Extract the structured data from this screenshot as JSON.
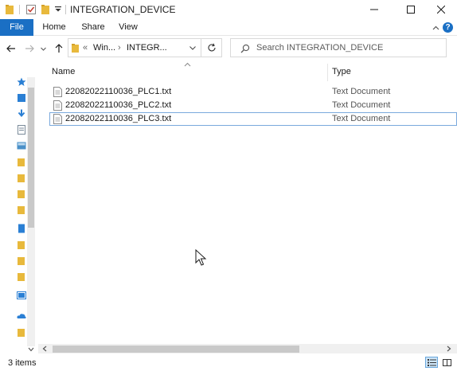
{
  "window": {
    "title": "INTEGRATION_DEVICE"
  },
  "ribbon": {
    "tabs": [
      "File",
      "Home",
      "Share",
      "View"
    ],
    "help_glyph": "?"
  },
  "navigation": {
    "address": {
      "overflow": "«",
      "segments": [
        "Win...",
        "INTEGR..."
      ],
      "separator": "›"
    },
    "search": {
      "placeholder": "Search INTEGRATION_DEVICE"
    }
  },
  "file_list": {
    "columns": [
      "Name",
      "Type"
    ],
    "rows": [
      {
        "name": "22082022110036_PLC1.txt",
        "type": "Text Document"
      },
      {
        "name": "22082022110036_PLC2.txt",
        "type": "Text Document"
      },
      {
        "name": "22082022110036_PLC3.txt",
        "type": "Text Document"
      }
    ],
    "focused_row": 2
  },
  "status": {
    "item_count": "3 items"
  },
  "colors": {
    "accent": "#1a6fc4",
    "folder": "#e8b93c",
    "nav_blue": "#2a7fd4"
  },
  "icons": {
    "folder": "folder-icon",
    "properties": "properties-icon",
    "new_folder": "new-folder-icon",
    "customize": "customize-toolbar-icon",
    "back": "back-arrow-icon",
    "forward": "forward-arrow-icon",
    "recent": "recent-locations-icon",
    "up": "up-arrow-icon",
    "refresh": "refresh-icon",
    "search": "search-icon",
    "text_file": "text-file-icon",
    "details_view": "details-view-icon",
    "large_icons_view": "large-icons-view-icon"
  }
}
